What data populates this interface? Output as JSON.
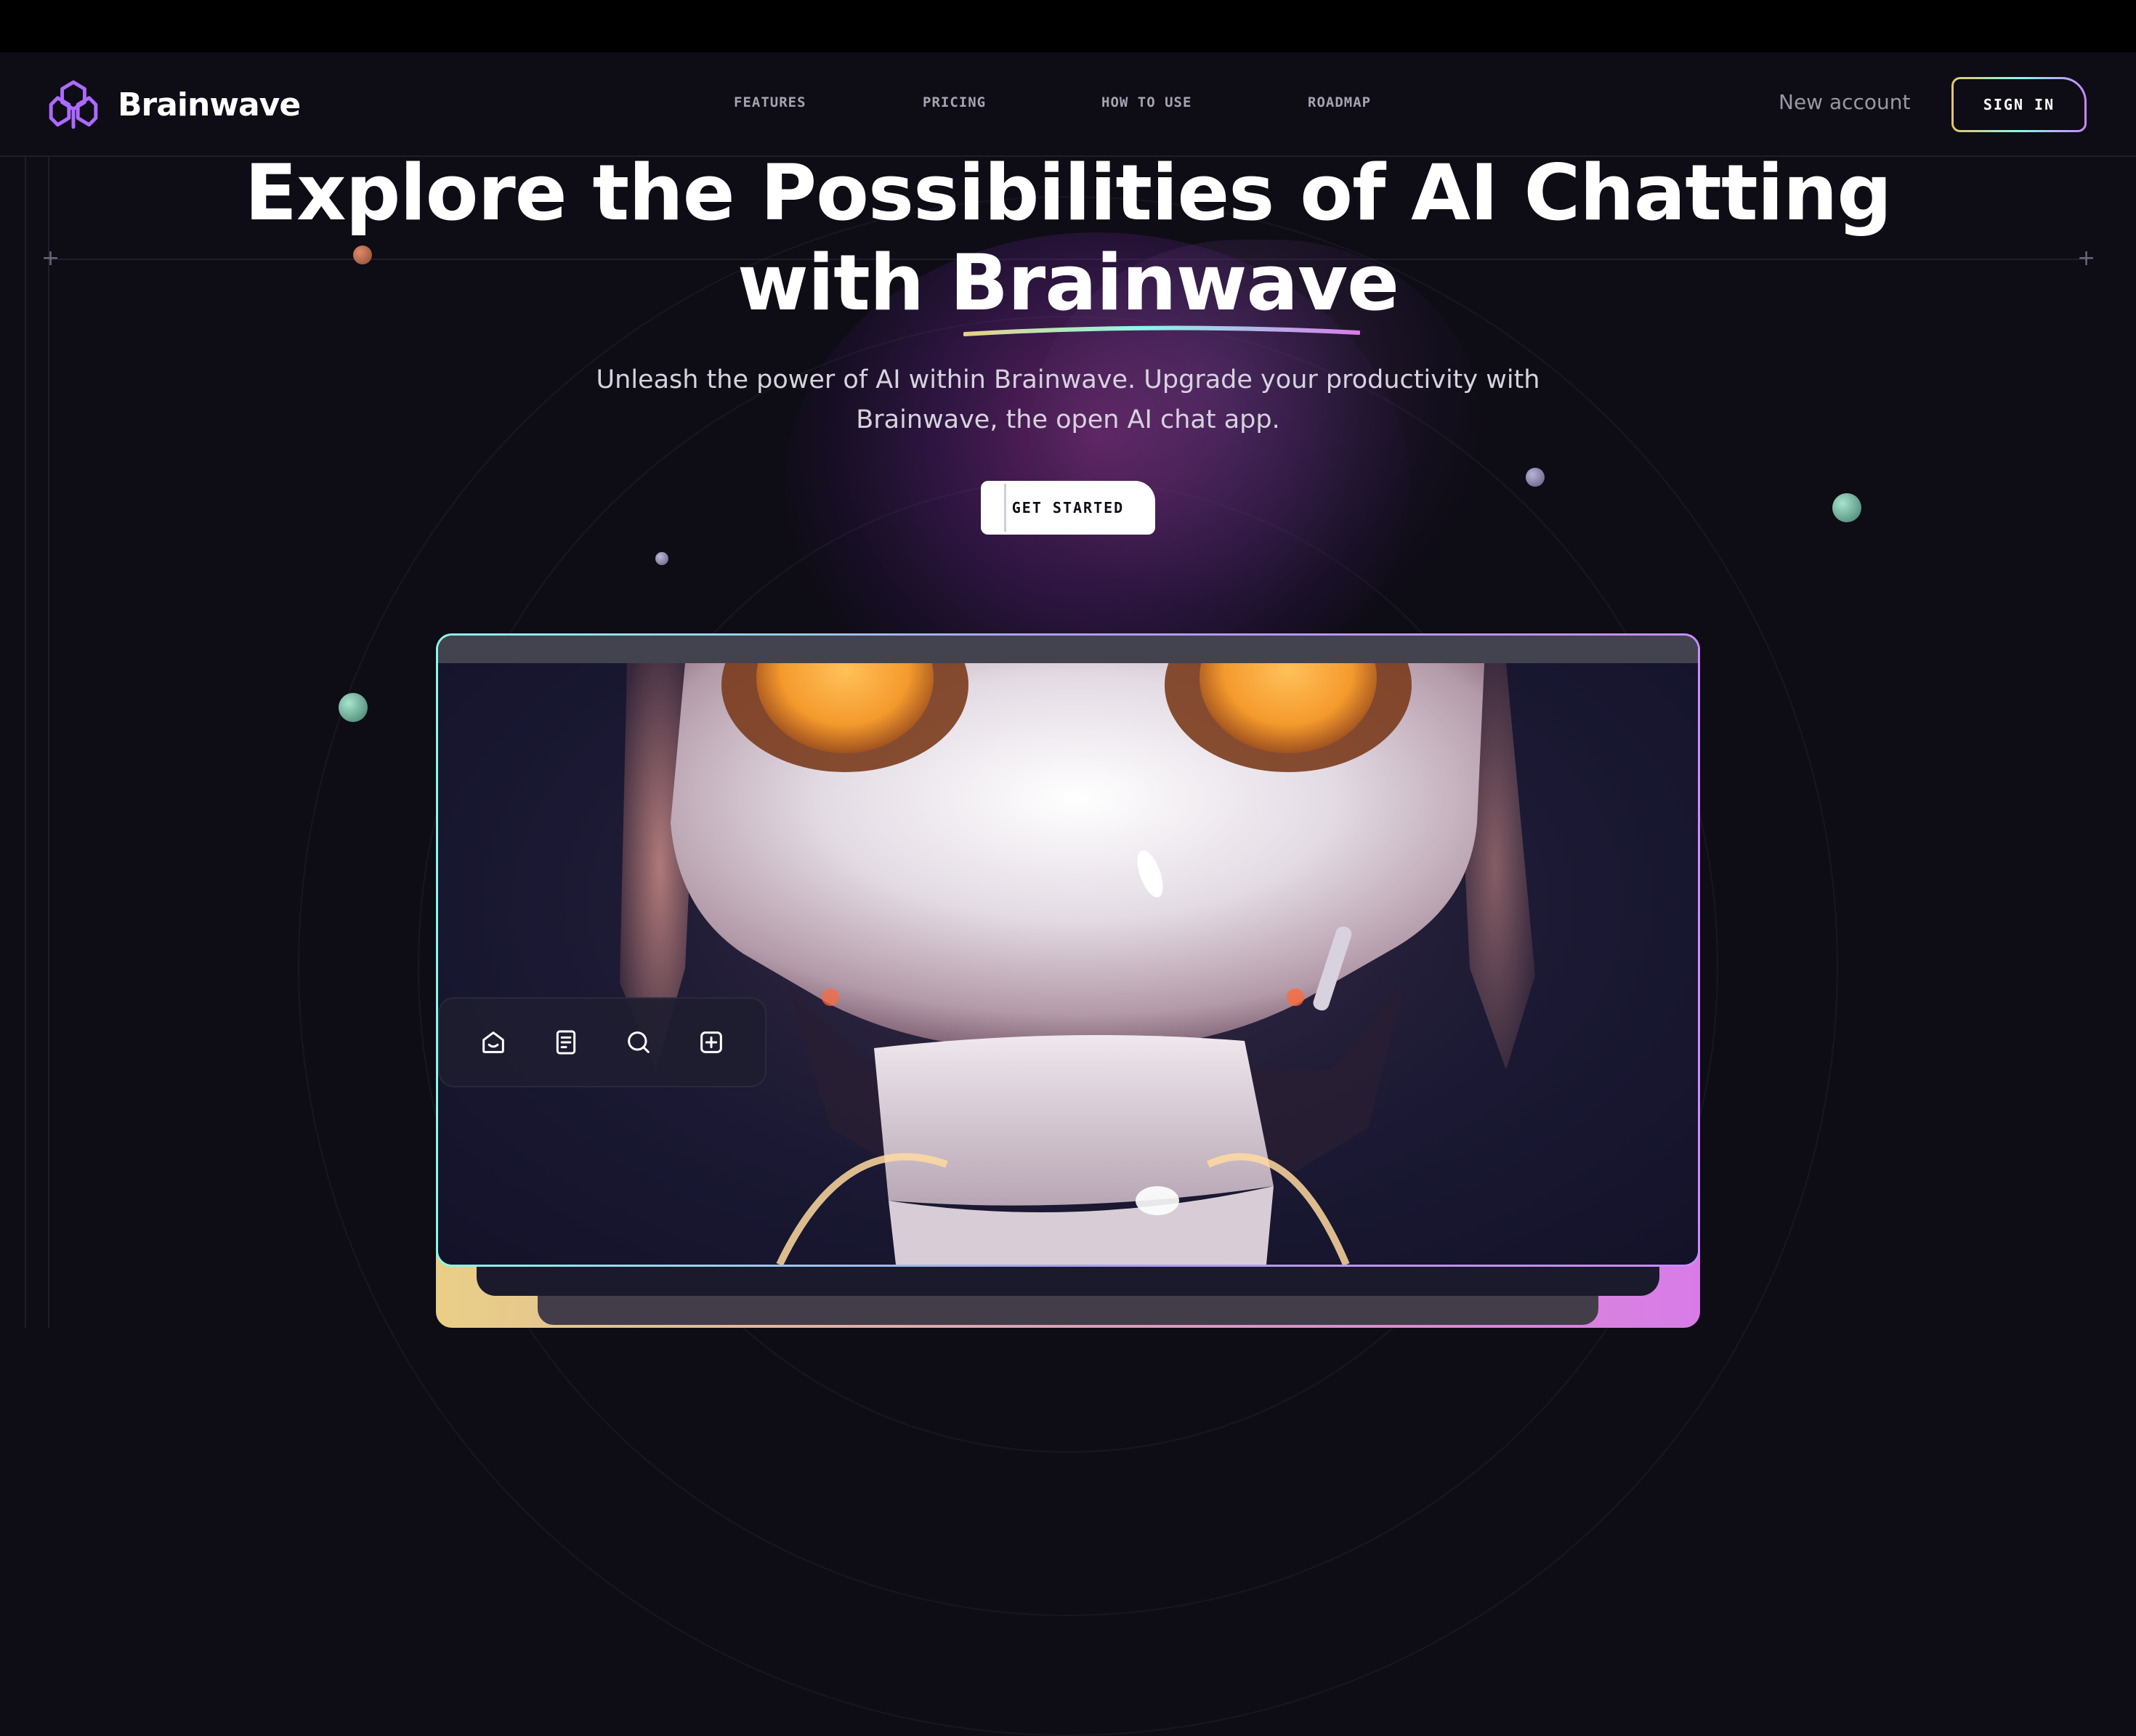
{
  "header": {
    "brand_name": "Brainwave",
    "nav": [
      "FEATURES",
      "PRICING",
      "HOW TO USE",
      "ROADMAP"
    ],
    "new_account": "New account",
    "sign_in": "SIGN IN"
  },
  "hero": {
    "title_line1": "Explore the Possibilities of AI Chatting",
    "title_line2_prefix": "with ",
    "title_line2_highlight": "Brainwave",
    "subtitle_line1": "Unleash the power of AI within Brainwave. Upgrade your productivity with",
    "subtitle_line2": "Brainwave, the open AI chat app.",
    "cta_label": "GET STARTED"
  },
  "preview": {
    "toolbar_icons": [
      "home-icon",
      "document-icon",
      "search-icon",
      "add-square-icon"
    ]
  },
  "colors": {
    "background": "#0e0c15",
    "accent_purple": "#ac6aff",
    "gradient_start": "#89f9e8",
    "gradient_end": "#c98bff",
    "base_gold": "#e9cf86",
    "base_pink": "#d87be8"
  }
}
